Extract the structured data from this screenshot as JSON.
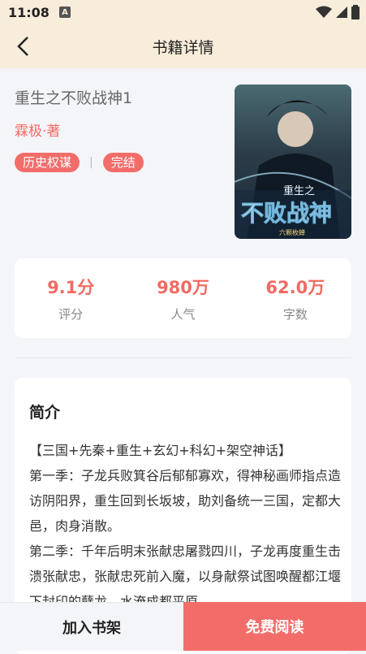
{
  "status": {
    "time": "11:08",
    "notif_glyph": "A"
  },
  "header": {
    "title": "书籍详情"
  },
  "book": {
    "title": "重生之不败战神1",
    "author": "霖极·著",
    "tags": [
      "历史权谋",
      "完结"
    ],
    "tag_separator": "|",
    "cover": {
      "line1": "重生之",
      "line2": "不败战神",
      "publisher": "六颗枚蝉"
    }
  },
  "stats": [
    {
      "value": "9.1分",
      "label": "评分"
    },
    {
      "value": "980万",
      "label": "人气"
    },
    {
      "value": "62.0万",
      "label": "字数"
    }
  ],
  "intro": {
    "heading": "简介",
    "paragraphs": [
      "【三国+先秦+重生+玄幻+科幻+架空神话】",
      "第一季：子龙兵败箕谷后郁郁寡欢，得神秘画师指点造访阴阳界，重生回到长坂坡，助刘备统一三国，定都大邑，肉身消散。",
      "第二季：千年后明末张献忠屠戮四川，子龙再度重生击溃张献忠，张献忠死前入魔，以身献祭试图唤醒都江堰下封印的孽龙，水淹成都平原"
    ]
  },
  "actions": {
    "add_shelf": "加入书架",
    "read_free": "免费阅读"
  },
  "colors": {
    "accent": "#f26d6a",
    "header_bg": "#f8ecda",
    "page_bg": "#f4f5f9"
  }
}
